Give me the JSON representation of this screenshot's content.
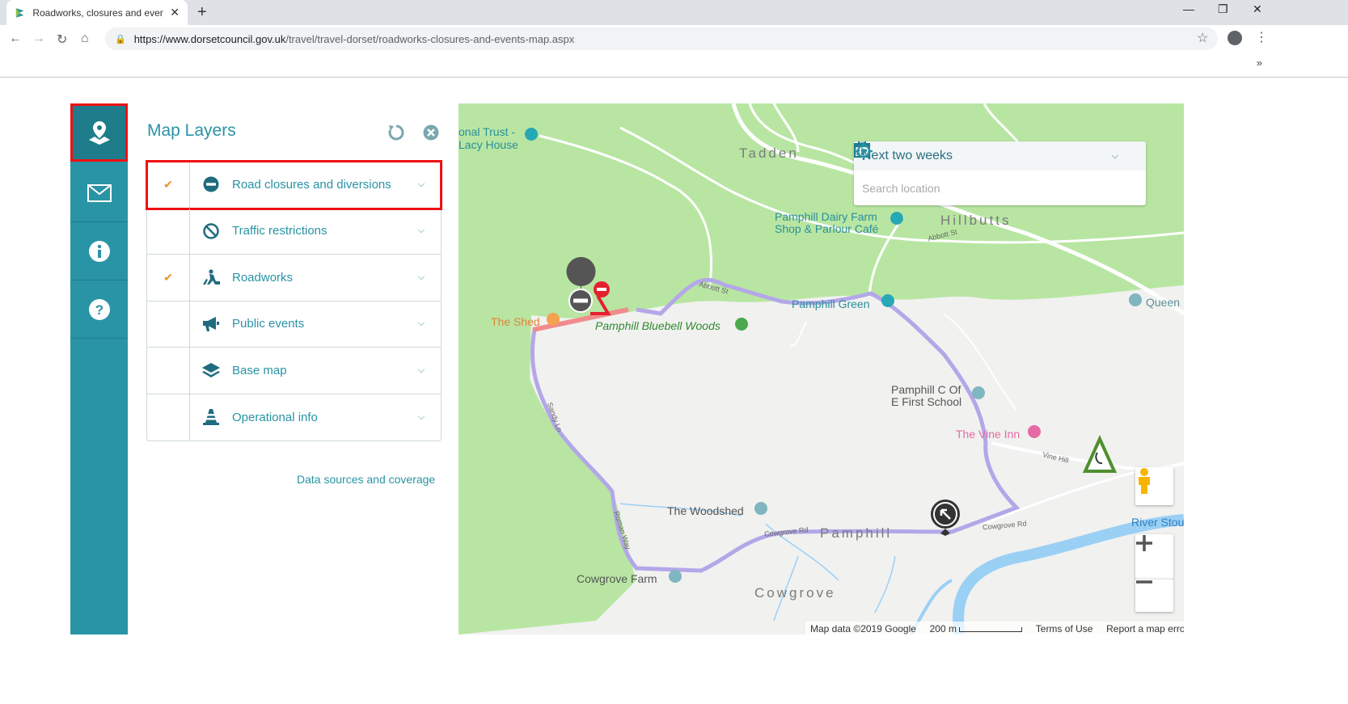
{
  "browser": {
    "tab_title": "Roadworks, closures and events",
    "tab_close": "✕",
    "new_tab": "+",
    "url_host": "https://www.dorsetcouncil.gov.uk",
    "url_path": "/travel/travel-dorset/roadworks-closures-and-events-map.aspx",
    "bookmarks_more": "»"
  },
  "rail": {
    "items": [
      "map-layers",
      "email",
      "info",
      "help"
    ]
  },
  "panel": {
    "title": "Map Layers",
    "layers": [
      {
        "label": "Road closures and diversions",
        "checked": "✔",
        "icon": "no-entry-icon"
      },
      {
        "label": "Traffic restrictions",
        "checked": "",
        "icon": "restriction-icon"
      },
      {
        "label": "Roadworks",
        "checked": "✔",
        "icon": "roadworks-icon"
      },
      {
        "label": "Public events",
        "checked": "",
        "icon": "megaphone-icon"
      },
      {
        "label": "Base map",
        "checked": "",
        "icon": "layers-icon"
      },
      {
        "label": "Operational info",
        "checked": "",
        "icon": "cone-icon"
      }
    ],
    "data_sources_link": "Data sources and coverage"
  },
  "map": {
    "filter_selected": "Next two weeks",
    "search_placeholder": "Search location",
    "places": {
      "national_trust": "onal Trust -",
      "lacy_house": "Lacy House",
      "tadden": "Tadden",
      "dairy_farm_1": "Pamphill Dairy Farm",
      "dairy_farm_2": "Shop & Parlour Café",
      "hillbutts": "Hillbutts",
      "pamphill_green": "Pamphill Green",
      "queen": "Queen",
      "the_shed": "The Shed",
      "bluebell_woods": "Pamphill Bluebell Woods",
      "school_1": "Pamphill C Of",
      "school_2": "E First School",
      "vine_inn": "The Vine Inn",
      "woodshed": "The Woodshed",
      "pamphill": "Pamphill",
      "cowgrove_farm": "Cowgrove Farm",
      "cowgrove": "Cowgrove",
      "river_stour": "River Stou"
    },
    "roads": {
      "abbott_st_1": "Abbott St",
      "abbott_st_2": "Abbott St",
      "sandy_ln": "Sandy Ln",
      "roman_way": "Roman Way",
      "cowgrove_rd_1": "Cowgrove Rd",
      "cowgrove_rd_2": "Cowgrove Rd",
      "vine_hill": "Vine Hill"
    },
    "attribution": {
      "data": "Map data ©2019 Google",
      "scale": "200 m",
      "terms": "Terms of Use",
      "report": "Report a map error"
    }
  },
  "colors": {
    "accent": "#2994a5",
    "checkmark": "#f09022",
    "highlight": "#ee1111",
    "route": "#b3a7e8",
    "closure": "#f08c8c"
  }
}
